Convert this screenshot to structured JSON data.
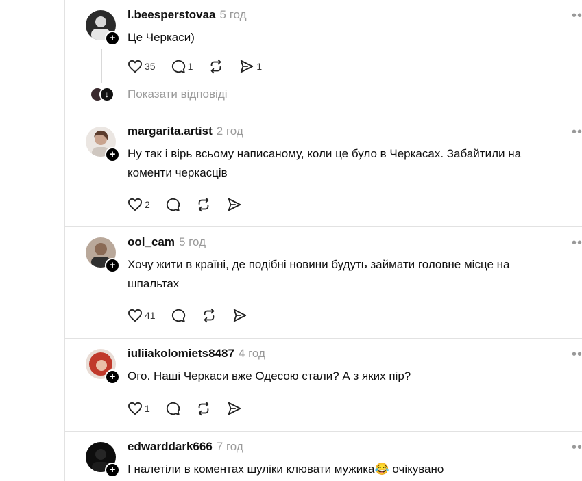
{
  "posts": [
    {
      "username": "l.beesperstovaa",
      "time": "5 год",
      "text": "Це Черкаси)",
      "likes": "35",
      "comments": "1",
      "reposts": "",
      "shares": "1",
      "show_replies": "Показати відповіді"
    },
    {
      "username": "margarita.artist",
      "time": "2 год",
      "text": "Ну так і вірь всьому написаному, коли це було в Черкасах. Забайтили на коменти черкасців",
      "likes": "2",
      "comments": "",
      "reposts": "",
      "shares": ""
    },
    {
      "username": "ool_cam",
      "time": "5 год",
      "text": "Хочу жити в країні, де подібні новини будуть займати головне місце на шпальтах",
      "likes": "41",
      "comments": "",
      "reposts": "",
      "shares": ""
    },
    {
      "username": "iuliiakolomiets8487",
      "time": "4 год",
      "text": "Ого. Наші Черкаси вже Одесою стали? А з яких пір?",
      "likes": "1",
      "comments": "",
      "reposts": "",
      "shares": ""
    },
    {
      "username": "edwarddark666",
      "time": "7 год",
      "text": "І налетіли в коментах шуліки клювати мужика😂 очікувано"
    }
  ],
  "icons": {
    "like": "heart-icon",
    "comment": "speech-bubble-icon",
    "repost": "repost-arrows-icon",
    "share": "paper-plane-icon",
    "follow": "plus-icon",
    "more": "more-dots-icon"
  },
  "colors": {
    "muted": "#9a9a9a",
    "divider": "#e2e2e2",
    "text": "#111111"
  }
}
